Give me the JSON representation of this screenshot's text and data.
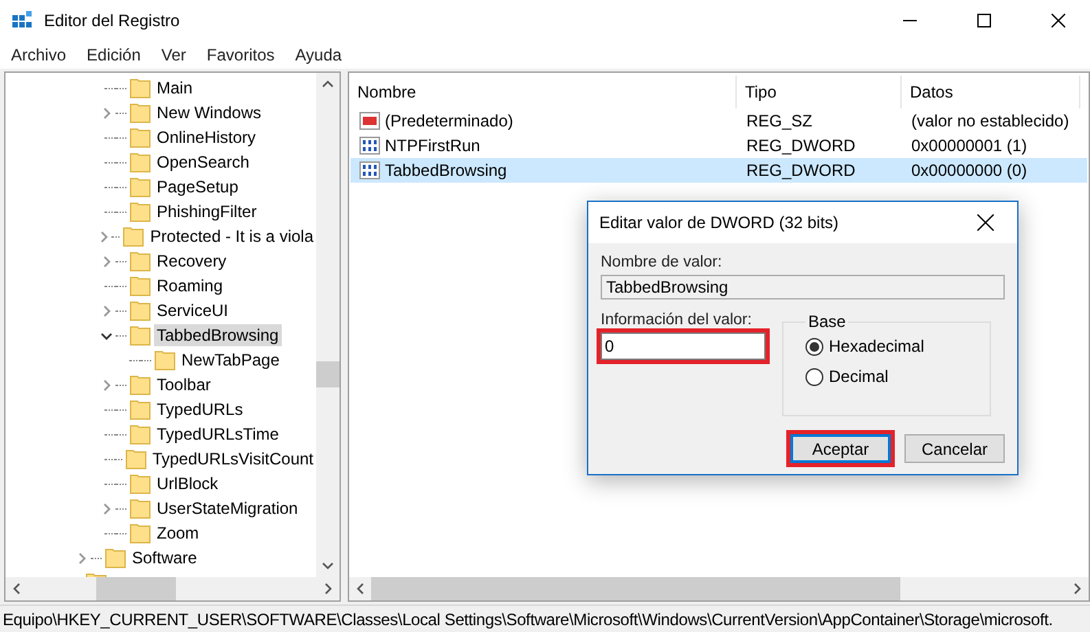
{
  "window": {
    "title": "Editor del Registro"
  },
  "menu": [
    "Archivo",
    "Edición",
    "Ver",
    "Favoritos",
    "Ayuda"
  ],
  "tree": {
    "items": [
      {
        "label": "Main",
        "kind": "leaf",
        "selected": false
      },
      {
        "label": "New Windows",
        "kind": "collapsed",
        "selected": false
      },
      {
        "label": "OnlineHistory",
        "kind": "leaf",
        "selected": false
      },
      {
        "label": "OpenSearch",
        "kind": "leaf",
        "selected": false
      },
      {
        "label": "PageSetup",
        "kind": "leaf",
        "selected": false
      },
      {
        "label": "PhishingFilter",
        "kind": "leaf",
        "selected": false
      },
      {
        "label": "Protected - It is a viola",
        "kind": "collapsed",
        "selected": false
      },
      {
        "label": "Recovery",
        "kind": "collapsed",
        "selected": false
      },
      {
        "label": "Roaming",
        "kind": "leaf",
        "selected": false
      },
      {
        "label": "ServiceUI",
        "kind": "collapsed",
        "selected": false
      },
      {
        "label": "TabbedBrowsing",
        "kind": "expanded",
        "selected": true,
        "children": [
          {
            "label": "NewTabPage",
            "kind": "leaf",
            "selected": false
          }
        ]
      },
      {
        "label": "Toolbar",
        "kind": "collapsed",
        "selected": false
      },
      {
        "label": "TypedURLs",
        "kind": "leaf",
        "selected": false
      },
      {
        "label": "TypedURLsTime",
        "kind": "leaf",
        "selected": false
      },
      {
        "label": "TypedURLsVisitCount",
        "kind": "leaf",
        "selected": false
      },
      {
        "label": "UrlBlock",
        "kind": "leaf",
        "selected": false
      },
      {
        "label": "UserStateMigration",
        "kind": "collapsed",
        "selected": false
      },
      {
        "label": "Zoom",
        "kind": "leaf",
        "selected": false
      }
    ],
    "outer_items": [
      {
        "label": "Software",
        "kind": "collapsed",
        "selected": false
      }
    ]
  },
  "values": {
    "columns": [
      "Nombre",
      "Tipo",
      "Datos"
    ],
    "rows": [
      {
        "kind": "string",
        "name": "(Predeterminado)",
        "type": "REG_SZ",
        "data": "(valor no establecido)",
        "selected": false
      },
      {
        "kind": "binary",
        "name": "NTPFirstRun",
        "type": "REG_DWORD",
        "data": "0x00000001 (1)",
        "selected": false
      },
      {
        "kind": "binary",
        "name": "TabbedBrowsing",
        "type": "REG_DWORD",
        "data": "0x00000000 (0)",
        "selected": true
      }
    ]
  },
  "dialog": {
    "title": "Editar valor de DWORD (32 bits)",
    "name_label": "Nombre de valor:",
    "name_value": "TabbedBrowsing",
    "data_label": "Información del valor:",
    "data_value": "0",
    "data_highlighted": true,
    "base_label": "Base",
    "bases": [
      {
        "label": "Hexadecimal",
        "selected": true
      },
      {
        "label": "Decimal",
        "selected": false
      }
    ],
    "buttons": [
      {
        "label": "Aceptar",
        "default": true,
        "highlighted": true
      },
      {
        "label": "Cancelar",
        "default": false,
        "highlighted": false
      }
    ]
  },
  "status_bar": "Equipo\\HKEY_CURRENT_USER\\SOFTWARE\\Classes\\Local Settings\\Software\\Microsoft\\Windows\\CurrentVersion\\AppContainer\\Storage\\microsoft."
}
